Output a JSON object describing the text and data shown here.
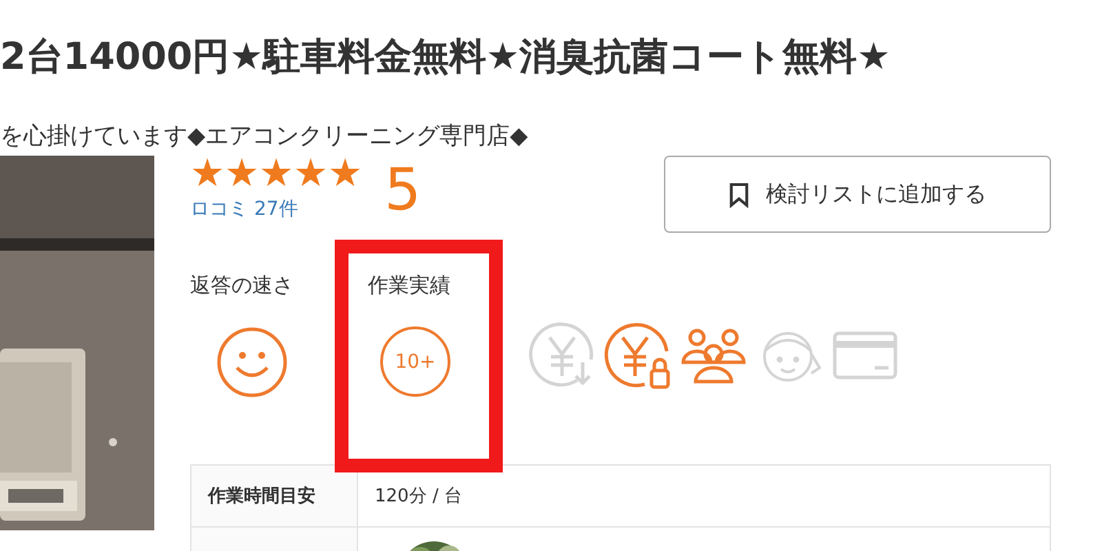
{
  "title": "2台14000円★駐車料金無料★消臭抗菌コート無料★",
  "subtitle": "を心掛けています◆エアコンクリーニング専門店◆",
  "rating": {
    "stars": 5,
    "score": "5",
    "reviews": "ロコミ 27件"
  },
  "add_button": "検討リストに追加する",
  "features": [
    {
      "label": "返答の速さ",
      "kind": "smile"
    },
    {
      "label": "作業実績",
      "kind": "count",
      "value": "10+"
    }
  ],
  "badges": [
    {
      "kind": "yen-down",
      "on": false
    },
    {
      "kind": "yen-lock",
      "on": true
    },
    {
      "kind": "people",
      "on": true
    },
    {
      "kind": "person",
      "on": false
    },
    {
      "kind": "card",
      "on": false
    }
  ],
  "highlight": {
    "shown": true
  },
  "table": {
    "rows": [
      {
        "header": "作業時間目安",
        "value": "120分 / 台"
      },
      {
        "header": ""
      }
    ]
  }
}
